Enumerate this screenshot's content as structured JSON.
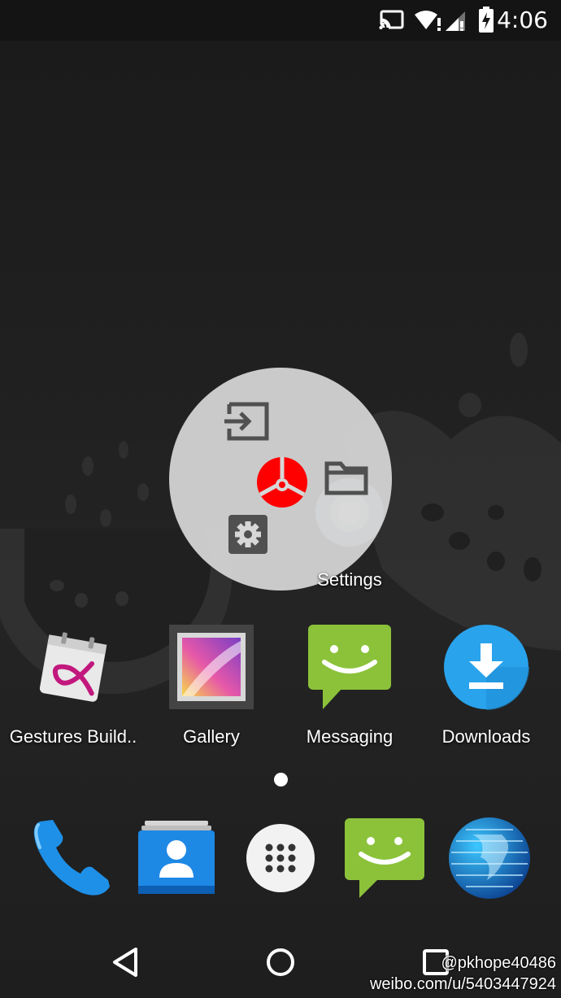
{
  "status_bar": {
    "time": "4:06",
    "icons": [
      "cast-icon",
      "wifi-icon",
      "signal-icon",
      "battery-charging-icon"
    ]
  },
  "radial_menu": {
    "items": [
      "sign-in-icon",
      "folder-icon",
      "gear-icon"
    ],
    "center": "red-orb-icon",
    "accent": "#ff0000",
    "background": "#d7d7d7"
  },
  "settings_app": {
    "label": "Settings"
  },
  "apps": [
    {
      "label": "Gestures Build..",
      "icon": "gestures-builder-icon"
    },
    {
      "label": "Gallery",
      "icon": "gallery-icon"
    },
    {
      "label": "Messaging",
      "icon": "messaging-icon"
    },
    {
      "label": "Downloads",
      "icon": "downloads-icon"
    }
  ],
  "dock": [
    "phone-icon",
    "contacts-icon",
    "app-drawer-icon",
    "messaging-icon",
    "browser-icon"
  ],
  "navbar": [
    "back-icon",
    "home-icon",
    "recents-icon"
  ],
  "watermark": {
    "line1": "@pkhope40486",
    "line2": "weibo.com/u/5403447924"
  }
}
